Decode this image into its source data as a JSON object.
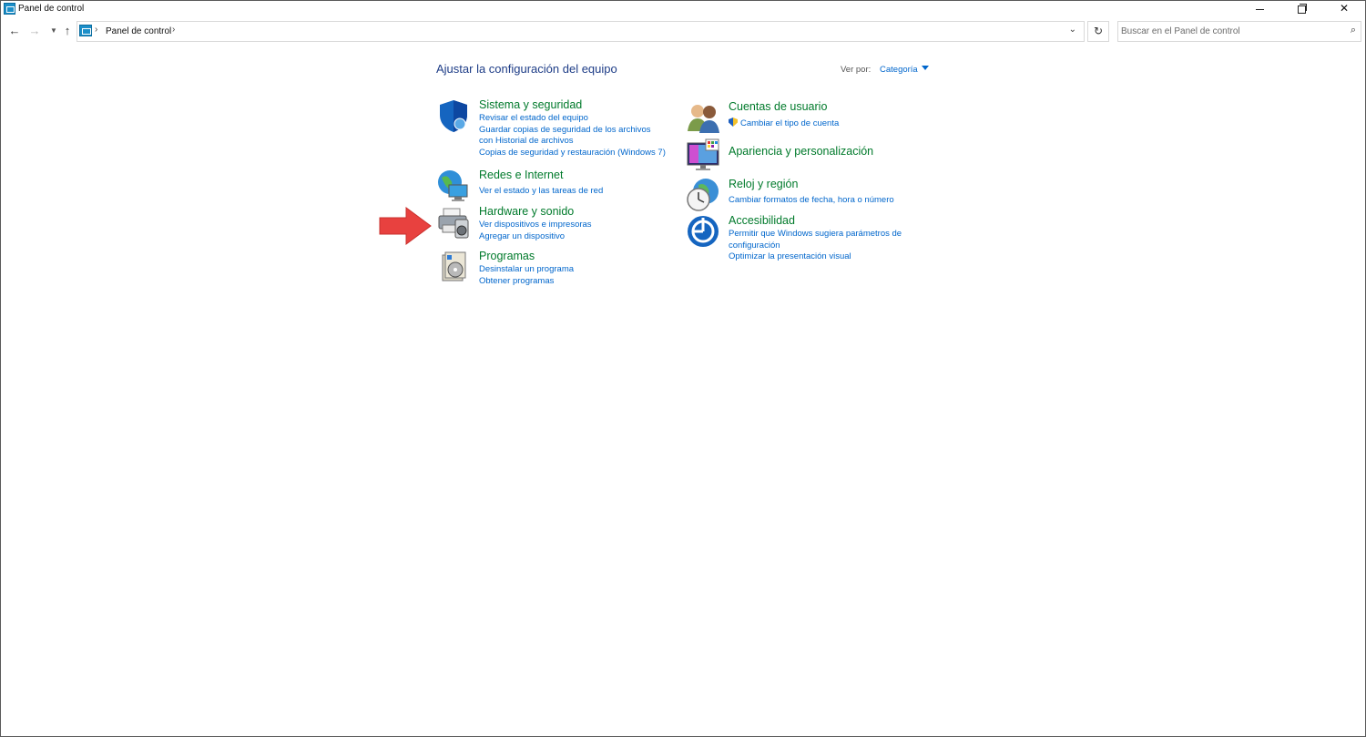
{
  "window": {
    "title": "Panel de control"
  },
  "navbar": {
    "breadcrumb": "Panel de control",
    "search_placeholder": "Buscar en el Panel de control"
  },
  "content": {
    "heading": "Ajustar la configuración del equipo",
    "view_by_label": "Ver por:",
    "view_by_value": "Categoría"
  },
  "categories": {
    "sistema": {
      "title": "Sistema y seguridad",
      "links": [
        "Revisar el estado del equipo",
        "Guardar copias de seguridad de los archivos con Historial de archivos",
        "Copias de seguridad y restauración (Windows 7)"
      ]
    },
    "redes": {
      "title": "Redes e Internet",
      "links": [
        "Ver el estado y las tareas de red"
      ]
    },
    "hardware": {
      "title": "Hardware y sonido",
      "links": [
        "Ver dispositivos e impresoras",
        "Agregar un dispositivo"
      ]
    },
    "programas": {
      "title": "Programas",
      "links": [
        "Desinstalar un programa",
        "Obtener programas"
      ]
    },
    "cuentas": {
      "title": "Cuentas de usuario",
      "links": [
        "Cambiar el tipo de cuenta"
      ]
    },
    "apariencia": {
      "title": "Apariencia y personalización",
      "links": []
    },
    "reloj": {
      "title": "Reloj y región",
      "links": [
        "Cambiar formatos de fecha, hora o número"
      ]
    },
    "accesibilidad": {
      "title": "Accesibilidad",
      "links": [
        "Permitir que Windows sugiera parámetros de configuración",
        "Optimizar la presentación visual"
      ]
    }
  },
  "colors": {
    "category_title": "#007a2b",
    "link": "#0066cc",
    "heading": "#1e3d87",
    "annotation_arrow": "#e8413f"
  },
  "icons": {
    "back": "arrow-left-icon",
    "forward": "arrow-right-icon",
    "recent": "chevron-down-icon",
    "up": "arrow-up-icon",
    "refresh": "refresh-icon",
    "search": "search-icon",
    "annotation": "red-arrow-icon"
  }
}
